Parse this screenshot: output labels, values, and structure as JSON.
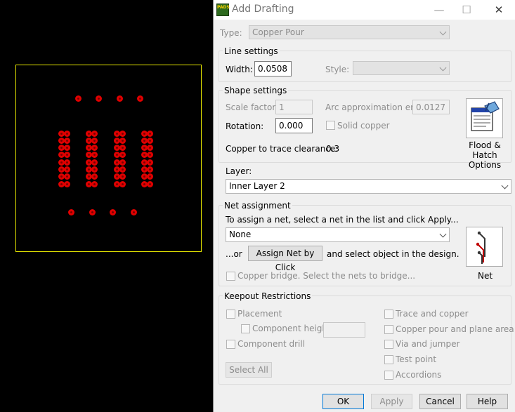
{
  "dialog": {
    "app_icon_text": "PADS",
    "title": "Add Drafting",
    "minimize_glyph": "—",
    "maximize_glyph": "☐",
    "close_glyph": "✕"
  },
  "type_row": {
    "label": "Type:",
    "value": "Copper Pour"
  },
  "line_settings": {
    "title": "Line settings",
    "width_label": "Width:",
    "width_value": "0.0508",
    "style_label": "Style:",
    "style_value": ""
  },
  "shape_settings": {
    "title": "Shape settings",
    "scale_label": "Scale factor:",
    "scale_value": "1",
    "arc_label": "Arc approximation error:",
    "arc_value": "0.0127",
    "rotation_label": "Rotation:",
    "rotation_value": "0.000",
    "solid_copper_label": "Solid copper",
    "clearance_label": "Copper to trace clearance:",
    "clearance_value": "0.3",
    "flood_button_label": "Flood & Hatch Options"
  },
  "layer": {
    "label": "Layer:",
    "value": "Inner Layer 2"
  },
  "net_assignment": {
    "title": "Net assignment",
    "instruction": "To assign a net, select a net in the list and click Apply...",
    "net_value": "None",
    "or_label": "...or",
    "assign_button": "Assign Net by Click",
    "after_assign": "and select object in the design.",
    "net_button_label": "Net",
    "copper_bridge_label": "Copper bridge. Select the nets to bridge..."
  },
  "keepout": {
    "title": "Keepout Restrictions",
    "placement": "Placement",
    "component_height": "Component height",
    "component_height_value": "",
    "component_drill": "Component drill",
    "trace_copper": "Trace and copper",
    "copper_pour_plane": "Copper pour and plane area",
    "via_jumper": "Via and jumper",
    "test_point": "Test point",
    "accordions": "Accordions",
    "select_all": "Select All"
  },
  "buttons": {
    "ok": "OK",
    "apply": "Apply",
    "cancel": "Cancel",
    "help": "Help"
  },
  "colors": {
    "board_outline": "#e6e600",
    "pad": "#e00000",
    "canvas_background": "#000000",
    "dialog_background": "#f0f0f0"
  },
  "icons": {
    "flood_hatch": "flood-hatch-icon",
    "net": "net-icon"
  }
}
